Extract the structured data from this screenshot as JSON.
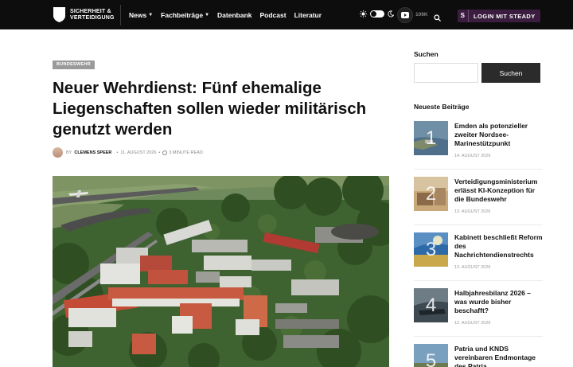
{
  "header": {
    "logo_line1": "SICHERHEIT &",
    "logo_line2": "VERTEIDIGUNG",
    "nav": [
      {
        "label": "News",
        "has_dropdown": true
      },
      {
        "label": "Fachbeiträge",
        "has_dropdown": true
      },
      {
        "label": "Datenbank",
        "has_dropdown": false
      },
      {
        "label": "Podcast",
        "has_dropdown": false
      },
      {
        "label": "Literatur",
        "has_dropdown": false
      }
    ],
    "youtube_count": "109K",
    "steady_icon": "S",
    "steady_label": "LOGIN MIT STEADY",
    "icons": [
      "shield-logo-icon",
      "sun-icon",
      "moon-icon",
      "youtube-icon",
      "search-icon",
      "chevron-down-icon"
    ]
  },
  "article": {
    "category": "BUNDESWEHR",
    "title": "Neuer Wehrdienst: Fünf ehemalige Liegenschaften sollen wieder militärisch genutzt werden",
    "by": "BY",
    "author": "CLEMENS SPEER",
    "date": "11. AUGUST 2026",
    "read_time": "3 MINUTE READ"
  },
  "sidebar": {
    "search_heading": "Suchen",
    "search_placeholder": "",
    "search_button": "Suchen",
    "latest_heading": "Neueste Beiträge",
    "posts": [
      {
        "num": "1",
        "title": "Emden als potenzieller zweiter Nordsee-Marinestützpunkt",
        "date": "14. AUGUST 2026"
      },
      {
        "num": "2",
        "title": "Verteidigungsministerium erlässt KI-Konzeption für die Bundeswehr",
        "date": "13. AUGUST 2026"
      },
      {
        "num": "3",
        "title": "Kabinett beschließt Reform des Nachrichtendienstrechts",
        "date": "13. AUGUST 2026"
      },
      {
        "num": "4",
        "title": "Halbjahresbilanz 2026 – was wurde bisher beschafft?",
        "date": "12. AUGUST 2026"
      },
      {
        "num": "5",
        "title": "Patria und KNDS vereinbaren Endmontage des Patria",
        "date": ""
      }
    ]
  },
  "colors": {
    "topbar": "#0d0d0d",
    "steady": "#3b1d40",
    "category_badge": "#9a9a9a",
    "search_button": "#2b2b2b"
  }
}
